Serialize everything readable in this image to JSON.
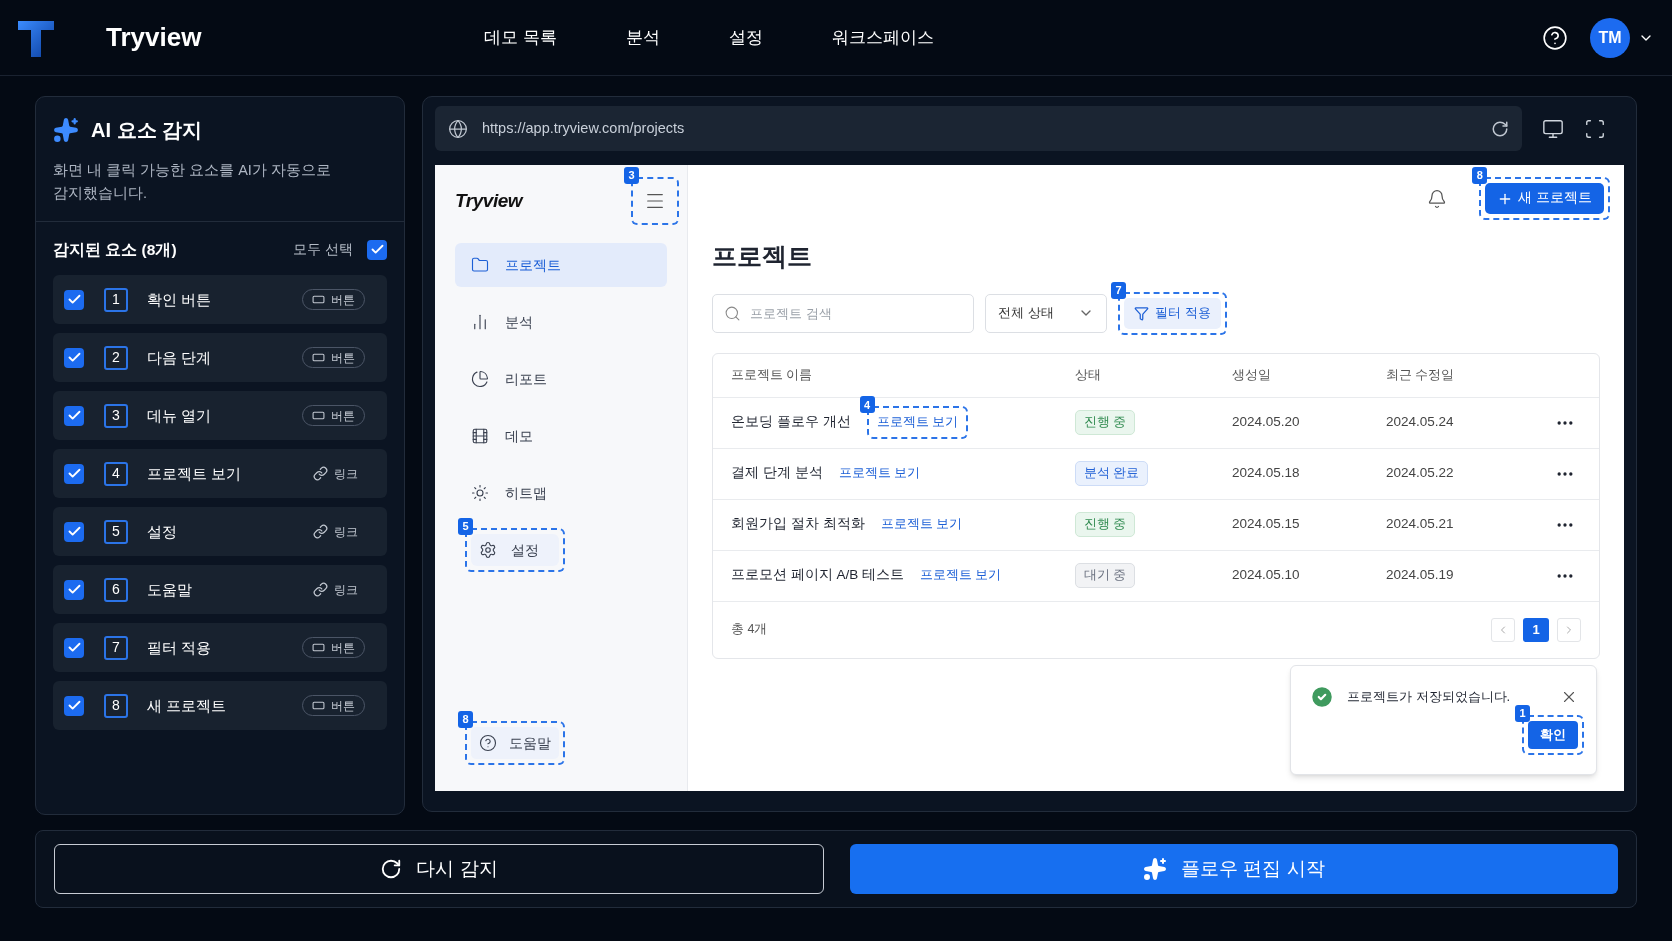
{
  "app_bar": {
    "logo": "Tryview",
    "nav": [
      {
        "label": "데모 목록"
      },
      {
        "label": "분석"
      },
      {
        "label": "설정"
      },
      {
        "label": "워크스페이스"
      }
    ],
    "avatar": "TM"
  },
  "detect_panel": {
    "title": "AI 요소 감지",
    "description": "화면 내 클릭 가능한 요소를 AI가 자동으로 감지했습니다.",
    "list_title": "감지된 요소 (8개)",
    "select_all": {
      "label": "모두 선택",
      "checked": true
    },
    "items": [
      {
        "number": "1",
        "label": "확인 버튼",
        "kind": "button",
        "type_label": "버튼",
        "checked": true
      },
      {
        "number": "2",
        "label": "다음 단계",
        "kind": "button",
        "type_label": "버튼",
        "checked": true
      },
      {
        "number": "3",
        "label": "데뉴 열기",
        "kind": "button",
        "type_label": "버튼",
        "checked": true
      },
      {
        "number": "4",
        "label": "프로젝트 보기",
        "kind": "link",
        "type_label": "링크",
        "checked": true
      },
      {
        "number": "5",
        "label": "설정",
        "kind": "link",
        "type_label": "링크",
        "checked": true
      },
      {
        "number": "6",
        "label": "도움말",
        "kind": "link",
        "type_label": "링크",
        "checked": true
      },
      {
        "number": "7",
        "label": "필터 적용",
        "kind": "button",
        "type_label": "버튼",
        "checked": true
      },
      {
        "number": "8",
        "label": "새 프로젝트",
        "kind": "button",
        "type_label": "버튼",
        "checked": true
      }
    ]
  },
  "preview": {
    "url": "https://app.tryview.com/projects",
    "app": {
      "logo": "Tryview",
      "menu_badge": "3",
      "sidebar": [
        {
          "label": "프로젝트",
          "selected": true
        },
        {
          "label": "분석",
          "selected": false
        },
        {
          "label": "리포트",
          "selected": false
        },
        {
          "label": "데모",
          "selected": false
        },
        {
          "label": "히트맵",
          "selected": false
        },
        {
          "label": "설정",
          "selected": false,
          "badge": "5"
        }
      ],
      "help": {
        "label": "도움말",
        "badge": "8"
      },
      "new_button": {
        "label": "새 프로젝트",
        "badge": "8"
      },
      "title": "프로젝트",
      "search": {
        "placeholder": "프로젝트 검색"
      },
      "status_select": "전체 상태",
      "filter_button": {
        "label": "필터 적용",
        "badge": "7"
      },
      "table": {
        "columns": [
          "프로젝트 이름",
          "상태",
          "생성일",
          "최근 수정일"
        ],
        "rows": [
          {
            "name": "온보딩 플로우 개선",
            "link": "프로젝트 보기",
            "link_badge": "4",
            "status": {
              "label": "진행 중",
              "kind": "active"
            },
            "created": "2024.05.20",
            "modified": "2024.05.24"
          },
          {
            "name": "결제 단계 분석",
            "link": "프로젝트 보기",
            "status": {
              "label": "분석 완료",
              "kind": "done"
            },
            "created": "2024.05.18",
            "modified": "2024.05.22"
          },
          {
            "name": "회원가입 절차 최적화",
            "link": "프로젝트 보기",
            "status": {
              "label": "진행 중",
              "kind": "active"
            },
            "created": "2024.05.15",
            "modified": "2024.05.21"
          },
          {
            "name": "프로모션 페이지 A/B 테스트",
            "link": "프로젝트 보기",
            "status": {
              "label": "대기 중",
              "kind": "waiting"
            },
            "created": "2024.05.10",
            "modified": "2024.05.19"
          }
        ],
        "total": "총 4개",
        "pages": [
          {
            "label": "1",
            "selected": true
          }
        ]
      },
      "toast": {
        "message": "프로젝트가 저장되었습니다.",
        "button": "확인",
        "badge": "1"
      }
    }
  },
  "actions": {
    "redetect": "다시 감지",
    "start": "플로우 편집 시작"
  }
}
